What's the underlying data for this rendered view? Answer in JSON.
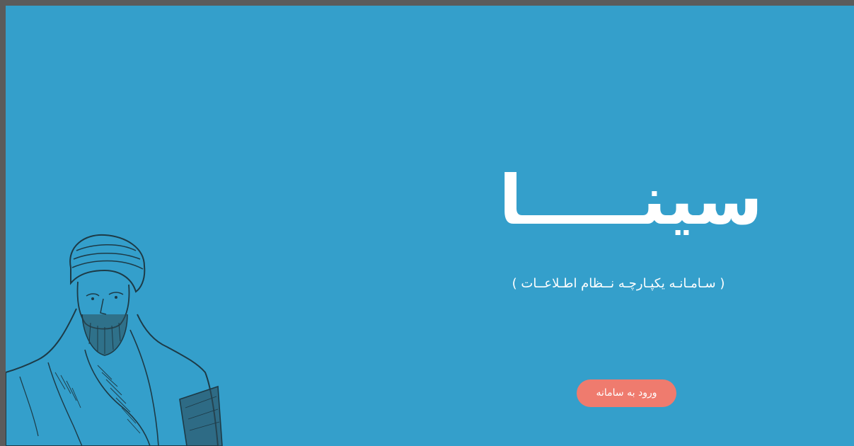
{
  "hero": {
    "title": "سینـــــا",
    "subtitle": "( سـامـانـه یکپـارچـه نــظام اطـلاعــات )",
    "enter_button_label": "ورود به سامانه"
  },
  "illustration": {
    "icon": "scholar-portrait-sketch"
  },
  "colors": {
    "background": "#349fcb",
    "frame_border": "#5b5b5b",
    "button": "#ef7b6e",
    "text": "#ffffff"
  }
}
